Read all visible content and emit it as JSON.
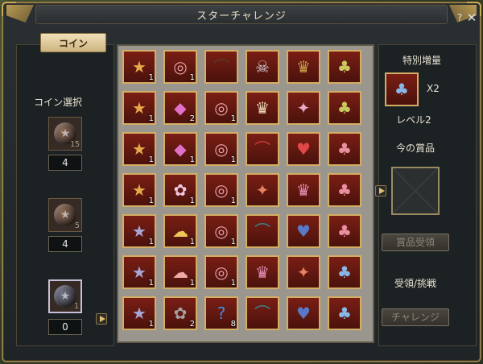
{
  "window": {
    "title": "スターチャレンジ"
  },
  "header": {
    "help": "?",
    "close": "✕"
  },
  "tabs": {
    "coin": "コイン"
  },
  "coin_select": {
    "label": "コイン選択",
    "slots": [
      {
        "count": "15",
        "qty": "4",
        "color": "#8a6a58"
      },
      {
        "count": "5",
        "qty": "4",
        "color": "#8a6a58"
      },
      {
        "count": "1",
        "qty": "0",
        "color": "#6e7488"
      }
    ]
  },
  "grid": {
    "rows": [
      [
        {
          "icon": "gold-coin",
          "glyph": "★",
          "color": "#e8a84a",
          "count": "1"
        },
        {
          "icon": "bandage",
          "glyph": "◎",
          "color": "#e9a0a8",
          "count": "1"
        },
        {
          "icon": "dark-wing",
          "glyph": "⌒",
          "color": "#5a3d2a",
          "count": ""
        },
        {
          "icon": "skull-heart",
          "glyph": "☠",
          "color": "#d8d0d8",
          "count": ""
        },
        {
          "icon": "golden-wing",
          "glyph": "♛",
          "color": "#c8a048",
          "count": ""
        },
        {
          "icon": "robot-pet",
          "glyph": "♣",
          "color": "#c8c860",
          "count": ""
        }
      ],
      [
        {
          "icon": "gold-coin",
          "glyph": "★",
          "color": "#e8a84a",
          "count": "1"
        },
        {
          "icon": "pink-crystal",
          "glyph": "◆",
          "color": "#e070c8",
          "count": "2"
        },
        {
          "icon": "bandage",
          "glyph": "◎",
          "color": "#e9a0a8",
          "count": "1"
        },
        {
          "icon": "angel-wing",
          "glyph": "♛",
          "color": "#f0d8b8",
          "count": ""
        },
        {
          "icon": "feather-wing",
          "glyph": "✦",
          "color": "#e8a8c8",
          "count": ""
        },
        {
          "icon": "robot-pet",
          "glyph": "♣",
          "color": "#c8c860",
          "count": ""
        }
      ],
      [
        {
          "icon": "gold-coin",
          "glyph": "★",
          "color": "#e8a84a",
          "count": "1"
        },
        {
          "icon": "pink-crystal",
          "glyph": "◆",
          "color": "#e070c8",
          "count": "1"
        },
        {
          "icon": "bandage",
          "glyph": "◎",
          "color": "#e9a0a8",
          "count": "1"
        },
        {
          "icon": "red-wing",
          "glyph": "⌒",
          "color": "#c83a3a",
          "count": ""
        },
        {
          "icon": "red-heart",
          "glyph": "♥",
          "color": "#e04848",
          "count": ""
        },
        {
          "icon": "pink-pet",
          "glyph": "♣",
          "color": "#e890a0",
          "count": ""
        }
      ],
      [
        {
          "icon": "gold-coin",
          "glyph": "★",
          "color": "#e8a84a",
          "count": "1"
        },
        {
          "icon": "paw-wand",
          "glyph": "✿",
          "color": "#f0c8e0",
          "count": "1"
        },
        {
          "icon": "bandage",
          "glyph": "◎",
          "color": "#e9a0a8",
          "count": "1"
        },
        {
          "icon": "phoenix",
          "glyph": "✦",
          "color": "#e88060",
          "count": ""
        },
        {
          "icon": "pink-crown-wing",
          "glyph": "♛",
          "color": "#e890b8",
          "count": ""
        },
        {
          "icon": "pink-pet",
          "glyph": "♣",
          "color": "#e890a0",
          "count": ""
        }
      ],
      [
        {
          "icon": "silver-coin",
          "glyph": "★",
          "color": "#a8a8d8",
          "count": "1"
        },
        {
          "icon": "yellow-cloud",
          "glyph": "☁",
          "color": "#f0c858",
          "count": "1"
        },
        {
          "icon": "bandage",
          "glyph": "◎",
          "color": "#e9a0a8",
          "count": "1"
        },
        {
          "icon": "teal-wing",
          "glyph": "⌒",
          "color": "#3a8088",
          "count": ""
        },
        {
          "icon": "blue-heart",
          "glyph": "♥",
          "color": "#5878c8",
          "count": ""
        },
        {
          "icon": "pink-pet",
          "glyph": "♣",
          "color": "#e890a0",
          "count": ""
        }
      ],
      [
        {
          "icon": "silver-coin",
          "glyph": "★",
          "color": "#a8a8d8",
          "count": "1"
        },
        {
          "icon": "pink-cloud",
          "glyph": "☁",
          "color": "#f0a8a8",
          "count": "1"
        },
        {
          "icon": "bandage",
          "glyph": "◎",
          "color": "#e9a0a8",
          "count": "1"
        },
        {
          "icon": "pink-wing",
          "glyph": "♛",
          "color": "#e890b8",
          "count": ""
        },
        {
          "icon": "phoenix",
          "glyph": "✦",
          "color": "#e88060",
          "count": ""
        },
        {
          "icon": "blue-pet",
          "glyph": "♣",
          "color": "#88b8e8",
          "count": ""
        }
      ],
      [
        {
          "icon": "silver-coin",
          "glyph": "★",
          "color": "#a8a8d8",
          "count": "1"
        },
        {
          "icon": "bear-paw",
          "glyph": "✿",
          "color": "#a8a0a0",
          "count": "2"
        },
        {
          "icon": "blue-question-box",
          "glyph": "?",
          "color": "#4888e0",
          "count": "8"
        },
        {
          "icon": "teal-wing",
          "glyph": "⌒",
          "color": "#3a8088",
          "count": ""
        },
        {
          "icon": "blue-heart",
          "glyph": "♥",
          "color": "#5878c8",
          "count": ""
        },
        {
          "icon": "blue-pet",
          "glyph": "♣",
          "color": "#88b8e8",
          "count": ""
        }
      ]
    ]
  },
  "right": {
    "boost_label": "特別増量",
    "boost_multiplier": "X2",
    "boost_icon": "robot-pet",
    "boost_glyph": "♣",
    "boost_color": "#88b8e8",
    "level": "レベル2",
    "current_reward_label": "今の賞品",
    "claim_button": "賞品受領",
    "claim_challenge_label": "受領/挑戦",
    "challenge_button": "チャレンジ"
  }
}
